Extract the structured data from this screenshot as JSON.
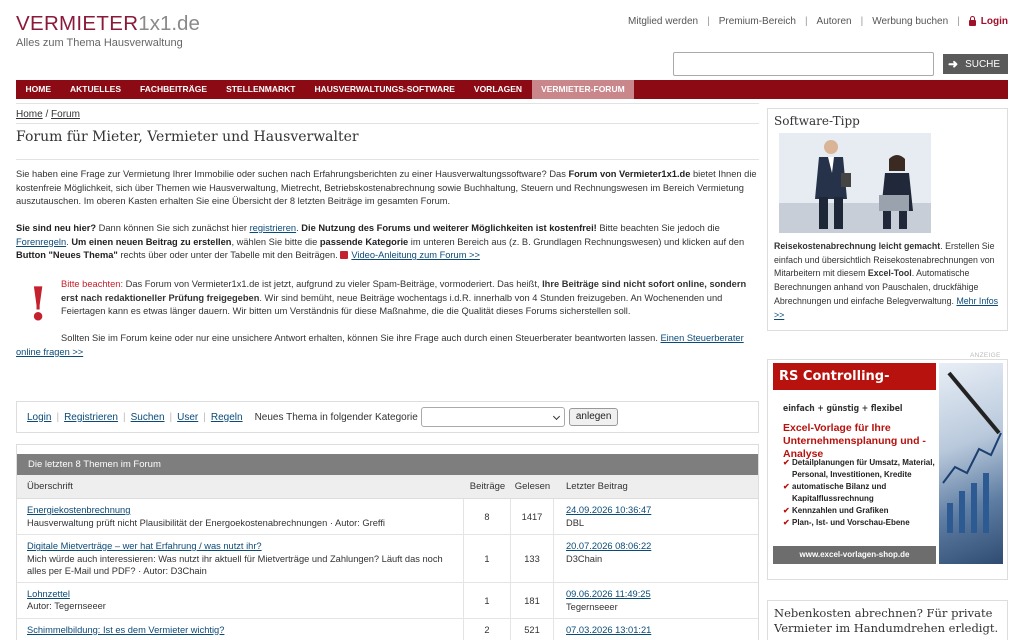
{
  "brand": {
    "name_part1": "VERMIETER",
    "name_part2": "1x1.de",
    "tagline": "Alles zum Thema Hausverwaltung"
  },
  "topnav": {
    "items": [
      "Mitglied werden",
      "Premium-Bereich",
      "Autoren",
      "Werbung buchen"
    ],
    "login": "Login"
  },
  "search": {
    "placeholder": "",
    "button": "SUCHE"
  },
  "mainnav": {
    "items": [
      "HOME",
      "AKTUELLES",
      "FACHBEITRÄGE",
      "STELLENMARKT",
      "HAUSVERWALTUNGS-SOFTWARE",
      "VORLAGEN",
      "VERMIETER-FORUM"
    ],
    "active_index": 6
  },
  "breadcrumb": {
    "home": "Home",
    "sep": "/",
    "current": "Forum"
  },
  "page": {
    "title": "Forum für Mieter, Vermieter und Hausverwalter",
    "intro": {
      "t1": "Sie haben eine Frage zur Vermietung Ihrer Immobilie oder suchen nach Erfahrungsberichten zu einer Hausverwaltungssoftware? Das ",
      "b1": "Forum von Vermieter1x1.de",
      "t2": " bietet Ihnen die kostenfreie Möglichkeit, sich über Themen wie Hausverwaltung, Mietrecht, Betriebskostenabrechnung sowie Buchhaltung, Steuern und Rechnungswesen im Bereich Vermietung auszutauschen. Im oberen Kasten erhalten Sie eine Übersicht der 8 letzten Beiträge im gesamten Forum."
    },
    "howto": {
      "b1": "Sie sind neu hier?",
      "t1": " Dann können Sie sich zunächst hier ",
      "l1": "registrieren",
      "t2": ". ",
      "b2": "Die Nutzung des Forums und weiterer Möglichkeiten ist kostenfrei!",
      "t3": " Bitte beachten Sie jedoch die ",
      "l2": "Forenregeln",
      "t4": ". ",
      "b3": "Um einen neuen Beitrag zu erstellen",
      "t5": ", wählen Sie bitte die ",
      "b4": "passende Kategorie",
      "t6": " im unteren Bereich aus (z. B. Grundlagen Rechnungswesen) und klicken auf den ",
      "b5": "Button \"Neues Thema\"",
      "t7": " rechts über oder unter der Tabelle mit den Beiträgen. ",
      "l3": "Video-Anleitung zum Forum >>"
    },
    "notice": {
      "hl": "Bitte beachten:",
      "t1": " Das Forum von Vermieter1x1.de ist jetzt, aufgrund zu vieler Spam-Beiträge, vormoderiert. Das heißt, ",
      "b1": "Ihre Beiträge sind nicht sofort online, sondern erst nach redaktioneller Prüfung freigegeben",
      "t2": ". Wir sind bemüht, neue Beiträge wochentags i.d.R. innerhalb von 4 Stunden freizugeben. An Wochenenden und Feiertagen kann es etwas länger dauern. Wir bitten um Verständnis für diese Maßnahme, die die Qualität dieses Forums sicherstellen soll."
    },
    "advisor": {
      "t1": "Sollten Sie im Forum keine oder nur eine unsichere Antwort erhalten, können Sie ihre Frage auch durch einen Steuerberater beantworten lassen.  ",
      "link": "Einen Steuerberater online fragen  >>"
    }
  },
  "forumbar": {
    "links": [
      "Login",
      "Registrieren",
      "Suchen",
      "User",
      "Regeln"
    ],
    "category_label": "Neues Thema in folgender Kategorie",
    "category_value": "",
    "button": "anlegen"
  },
  "topics": {
    "caption": "Die letzten 8 Themen im Forum",
    "headers": [
      "Überschrift",
      "Beiträge",
      "Gelesen",
      "Letzter Beitrag"
    ],
    "rows": [
      {
        "title": "Energiekostenbrechnung",
        "sub": "Hausverwaltung prüft nicht Plausibilität der Energoekostenabrechnungen · Autor: Greffi",
        "posts": "8",
        "reads": "1417",
        "last_date": "24.09.2026 10:36:47",
        "last_user": "DBL"
      },
      {
        "title": "Digitale Mietverträge – wer hat Erfahrung / was nutzt ihr?",
        "sub": "Mich würde auch interessieren: Was nutzt ihr aktuell für Mietverträge und Zahlungen? Läuft das noch alles per E-Mail und PDF? · Autor: D3Chain",
        "posts": "1",
        "reads": "133",
        "last_date": "20.07.2026 08:06:22",
        "last_user": "D3Chain"
      },
      {
        "title": "Lohnzettel",
        "sub": "Autor: Tegernseeer",
        "posts": "1",
        "reads": "181",
        "last_date": "09.06.2026 11:49:25",
        "last_user": "Tegernseeer"
      },
      {
        "title": "Schimmelbildung: Ist es dem Vermieter wichtig?",
        "sub": "",
        "posts": "2",
        "reads": "521",
        "last_date": "07.03.2026 13:01:21",
        "last_user": ""
      }
    ]
  },
  "sidebar": {
    "software_tip": {
      "title": "Software-Tipp",
      "b1": "Reisekostenabrechnung leicht gemacht",
      "t1": ". Erstellen Sie einfach und übersichtlich Reisekostenabrechnungen von Mitarbeitern mit diesem ",
      "b2": "Excel-Tool",
      "t2": ". Automatische Berechnungen anhand von Pauschalen, druckfähige Abrechnungen und einfache Belegverwaltung. ",
      "link": "Mehr Infos >>"
    },
    "ad_label": "ANZEIGE",
    "ad": {
      "head": "RS Controlling- System",
      "tag": "einfach + günstig + flexibel",
      "title": "Excel-Vorlage für Ihre Unternehmensplanung und -Analyse",
      "items": [
        "Detailplanungen für Umsatz, Material, Personal, Investitionen, Kredite",
        "automatische Bilanz und Kapitalflussrechnung",
        "Kennzahlen und Grafiken",
        "Plan-, Ist- und Vorschau-Ebene"
      ],
      "url": "www.excel-vorlagen-shop.de"
    },
    "nk_teaser": "Nebenkosten abrechnen? Für private Vermieter im Handumdrehen erledigt."
  }
}
